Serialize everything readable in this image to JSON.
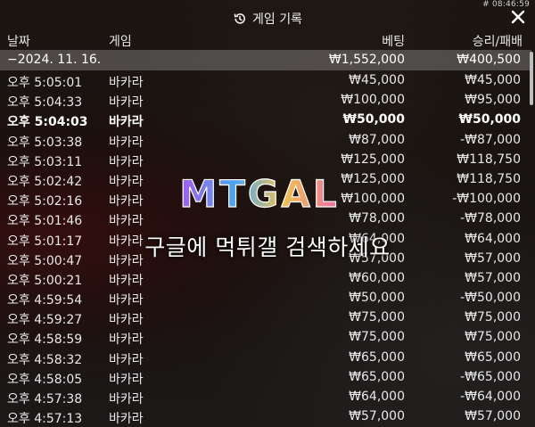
{
  "clock": "# 08:46:59",
  "title": "게임 기록",
  "columns": {
    "date": "날짜",
    "game": "게임",
    "bet": "베팅",
    "result": "승리/패배"
  },
  "summary": {
    "date": "−2024. 11. 16.",
    "bet": "₩1,552,000",
    "result": "₩400,500"
  },
  "rows": [
    {
      "date": "오후 5:05:01",
      "game": "바카라",
      "bet": "₩45,000",
      "result": "₩45,000"
    },
    {
      "date": "오후 5:04:33",
      "game": "바카라",
      "bet": "₩100,000",
      "result": "₩95,000"
    },
    {
      "date": "오후 5:04:03",
      "game": "바카라",
      "bet": "₩50,000",
      "result": "₩50,000"
    },
    {
      "date": "오후 5:03:38",
      "game": "바카라",
      "bet": "₩87,000",
      "result": "-₩87,000"
    },
    {
      "date": "오후 5:03:11",
      "game": "바카라",
      "bet": "₩125,000",
      "result": "₩118,750"
    },
    {
      "date": "오후 5:02:42",
      "game": "바카라",
      "bet": "₩125,000",
      "result": "₩118,750"
    },
    {
      "date": "오후 5:02:16",
      "game": "바카라",
      "bet": "₩100,000",
      "result": "-₩100,000"
    },
    {
      "date": "오후 5:01:46",
      "game": "바카라",
      "bet": "₩78,000",
      "result": "-₩78,000"
    },
    {
      "date": "오후 5:01:17",
      "game": "바카라",
      "bet": "₩64,000",
      "result": "₩64,000"
    },
    {
      "date": "오후 5:00:47",
      "game": "바카라",
      "bet": "₩57,000",
      "result": "₩57,000"
    },
    {
      "date": "오후 5:00:21",
      "game": "바카라",
      "bet": "₩60,000",
      "result": "₩57,000"
    },
    {
      "date": "오후 4:59:54",
      "game": "바카라",
      "bet": "₩50,000",
      "result": "-₩50,000"
    },
    {
      "date": "오후 4:59:27",
      "game": "바카라",
      "bet": "₩75,000",
      "result": "₩75,000"
    },
    {
      "date": "오후 4:58:59",
      "game": "바카라",
      "bet": "₩75,000",
      "result": "₩75,000"
    },
    {
      "date": "오후 4:58:32",
      "game": "바카라",
      "bet": "₩65,000",
      "result": "₩65,000"
    },
    {
      "date": "오후 4:58:05",
      "game": "바카라",
      "bet": "₩65,000",
      "result": "-₩65,000"
    },
    {
      "date": "오후 4:57:38",
      "game": "바카라",
      "bet": "₩64,000",
      "result": "-₩64,000"
    },
    {
      "date": "오후 4:57:13",
      "game": "바카라",
      "bet": "₩57,000",
      "result": "₩57,000"
    }
  ],
  "highlight_row": 2,
  "logo_text": "MTGAL",
  "watermark": "구글에 먹튀갤 검색하세요",
  "icons": {
    "history": "history-icon",
    "close": "close-icon"
  }
}
